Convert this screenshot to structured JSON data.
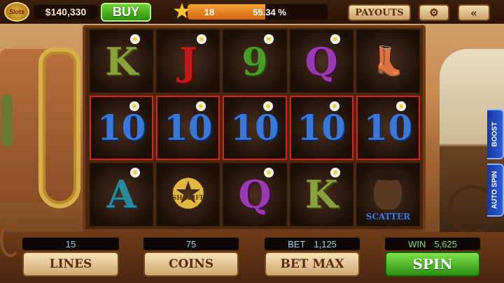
{
  "header": {
    "logo_text": "Slots",
    "balance": "$140,330",
    "buy_label": "BUY",
    "level": "18",
    "xp_percent": "55.34 %",
    "xp_fraction": 0.5534,
    "payouts_label": "PAYOUTS",
    "settings_icon": "gear-icon",
    "back_icon": "double-chevron-left-icon"
  },
  "reels": [
    [
      "K",
      "J",
      "9",
      "Q",
      "boots"
    ],
    [
      "10",
      "10",
      "10",
      "10",
      "10"
    ],
    [
      "A",
      "badge",
      "Q",
      "K",
      "scatter"
    ]
  ],
  "reel_labels": {
    "badge_text": "SHERIFF",
    "scatter_text": "SCATTER"
  },
  "side": {
    "boost_label": "BOOST",
    "autospin_label": "AUTO SPIN"
  },
  "footer": {
    "lines_value": "15",
    "coins_value": "75",
    "bet_label": "BET",
    "bet_value": "1,125",
    "win_label": "WIN",
    "win_value": "5,625",
    "lines_button": "LINES",
    "coins_button": "COINS",
    "betmax_button": "BET MAX",
    "spin_button": "SPIN"
  },
  "colors": {
    "win_line": "#d8221a",
    "spin_green": "#2a9012",
    "accent_gold": "#e0b840"
  }
}
